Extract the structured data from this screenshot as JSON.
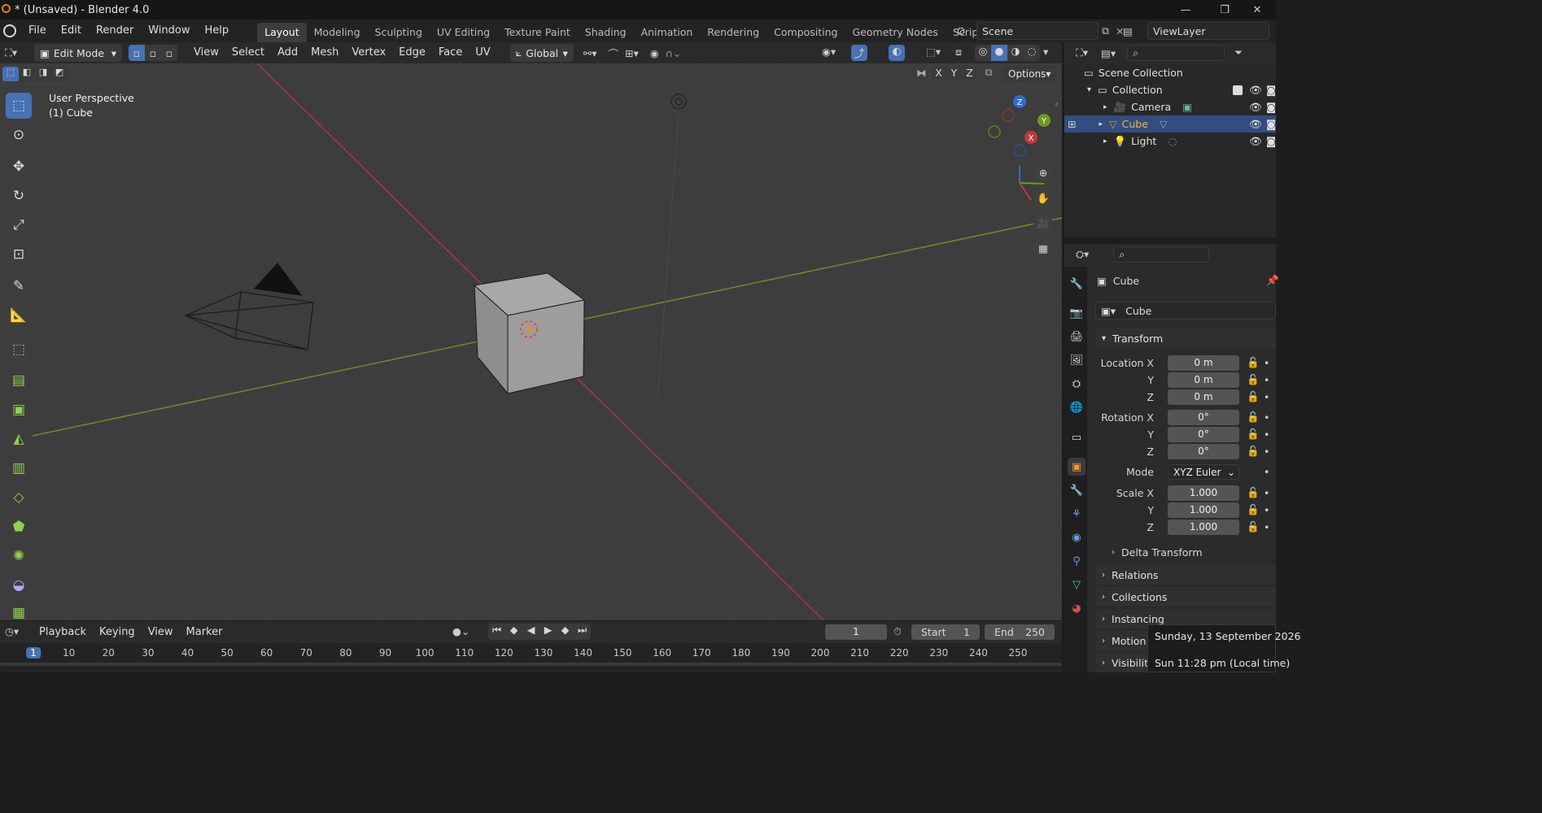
{
  "titlebar": {
    "title": "* (Unsaved) - Blender 4.0",
    "min": "—",
    "max": "❐",
    "close": "✕"
  },
  "menu": [
    "File",
    "Edit",
    "Render",
    "Window",
    "Help"
  ],
  "workspaces": [
    "Layout",
    "Modeling",
    "Sculpting",
    "UV Editing",
    "Texture Paint",
    "Shading",
    "Animation",
    "Rendering",
    "Compositing",
    "Geometry Nodes",
    "Scripting"
  ],
  "scene": "Scene",
  "viewlayer": "ViewLayer",
  "viewport_header": {
    "mode": "Edit Mode",
    "menus": [
      "View",
      "Select",
      "Add",
      "Mesh",
      "Vertex",
      "Edge",
      "Face",
      "UV"
    ],
    "orientation": "Global",
    "options": "Options",
    "axes": [
      "X",
      "Y",
      "Z"
    ]
  },
  "viewport": {
    "perspective": "User Perspective",
    "object": "(1) Cube"
  },
  "gizmo": {
    "z": "Z",
    "y": "Y",
    "x": "X"
  },
  "outliner": {
    "scene_collection": "Scene Collection",
    "collection": "Collection",
    "items": [
      "Camera",
      "Cube",
      "Light"
    ]
  },
  "properties": {
    "object_name": "Cube",
    "data_name": "Cube",
    "transform": "Transform",
    "location_label": "Location X",
    "rotation_label": "Rotation X",
    "scale_label": "Scale X",
    "y": "Y",
    "z": "Z",
    "location": [
      "0 m",
      "0 m",
      "0 m"
    ],
    "rotation": [
      "0°",
      "0°",
      "0°"
    ],
    "mode_label": "Mode",
    "mode": "XYZ Euler",
    "scale": [
      "1.000",
      "1.000",
      "1.000"
    ],
    "panels": [
      "Delta Transform",
      "Relations",
      "Collections",
      "Instancing",
      "Motion P",
      "Visibility"
    ]
  },
  "timeline": {
    "menus": [
      "Playback",
      "Keying",
      "View",
      "Marker"
    ],
    "current_frame": "1",
    "start_label": "Start",
    "start": "1",
    "end_label": "End",
    "end": "250",
    "ticks": [
      "1",
      "10",
      "20",
      "30",
      "40",
      "50",
      "60",
      "70",
      "80",
      "90",
      "100",
      "110",
      "120",
      "130",
      "140",
      "150",
      "160",
      "170",
      "180",
      "190",
      "200",
      "210",
      "220",
      "230",
      "240",
      "250"
    ]
  },
  "tooltip": {
    "date": "Sunday, 13 September 2026",
    "time": "Sun 11:28 pm (Local time)"
  },
  "colors": {
    "accent": "#4772b3",
    "x_axis": "#c23a3a",
    "y_axis": "#6a9c1e",
    "highlight": "#ff8a00"
  }
}
